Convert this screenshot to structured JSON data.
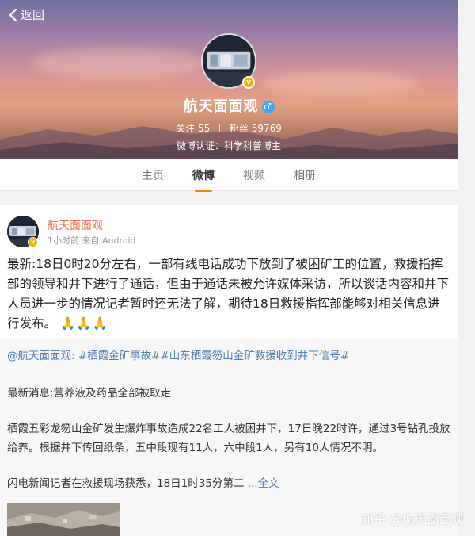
{
  "header": {
    "back_label": "返回",
    "profile_name": "航天面面观",
    "follow_label": "关注",
    "follow_count": "55",
    "fans_label": "粉丝",
    "fans_count": "59769",
    "verification": "微博认证：科学科普博主"
  },
  "tabs": [
    {
      "label": "主页",
      "active": false
    },
    {
      "label": "微博",
      "active": true
    },
    {
      "label": "视频",
      "active": false
    },
    {
      "label": "相册",
      "active": false
    }
  ],
  "post": {
    "author": "航天面面观",
    "meta": "1小时前 来自 Android",
    "body": "最新:18日0时20分左右，一部有线电话成功下放到了被困矿工的位置，救援指挥部的领导和井下进行了通话，但由于通话未被允许媒体采访，所以谈话内容和井下人员进一步的情况记者暂时还无法了解，期待18日救援指挥部能够对相关信息进行发布。",
    "emoji": "🙏🙏🙏"
  },
  "repost": {
    "mention": "@航天面面观:",
    "tags": "#栖霞金矿事故##山东栖霞笏山金矿救援收到井下信号#",
    "line1": "最新消息:营养液及药品全部被取走",
    "line2": "栖霞五彩龙笏山金矿发生爆炸事故造成22名工人被困井下，17日晚22时许，通过3号钻孔投放给养。根据井下传回纸条，五中段现有11人，六中段1人，另有10人情况不明。",
    "line3": "闪电新闻记者在救援现场获悉，18日1时35分第二",
    "more_label": "...全文"
  },
  "watermark": "知乎 @航天面面观",
  "colors": {
    "accent": "#ff8200",
    "username": "#eb7350",
    "link": "#507daf",
    "badge": "#f6b200"
  }
}
